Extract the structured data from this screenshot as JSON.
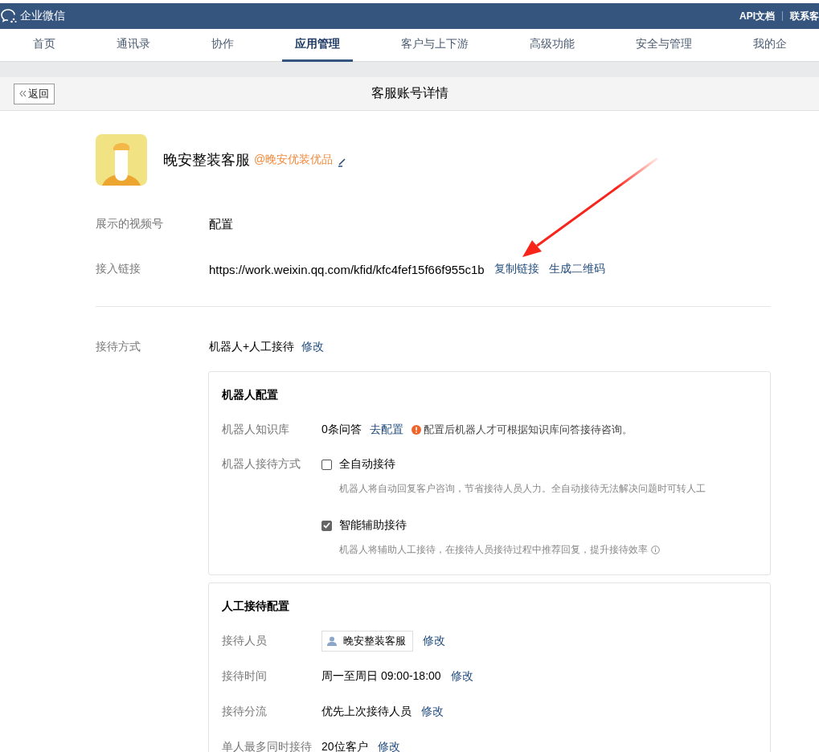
{
  "brand": {
    "name": "企业微信"
  },
  "top_links": [
    "API文档",
    "联系客"
  ],
  "nav": [
    {
      "label": "首页",
      "selected": false
    },
    {
      "label": "通讯录",
      "selected": false
    },
    {
      "label": "协作",
      "selected": false
    },
    {
      "label": "应用管理",
      "selected": true
    },
    {
      "label": "客户与上下游",
      "selected": false
    },
    {
      "label": "高级功能",
      "selected": false
    },
    {
      "label": "安全与管理",
      "selected": false
    },
    {
      "label": "我的企",
      "selected": false
    }
  ],
  "header": {
    "back": "返回",
    "title": "客服账号详情"
  },
  "account": {
    "name": "晚安整装客服",
    "corp": "@晚安优装优品"
  },
  "info_rows": [
    {
      "label": "展示的视频号",
      "value": "配置",
      "links": []
    },
    {
      "label": "接入链接",
      "value": "https://work.weixin.qq.com/kfid/kfc4fef15f66f955c1b",
      "links": [
        "复制链接",
        "生成二维码"
      ]
    }
  ],
  "reception": {
    "label": "接待方式",
    "value": "机器人+人工接待",
    "link": "修改"
  },
  "robot": {
    "title": "机器人配置",
    "knowledge": {
      "label": "机器人知识库",
      "value": "0条问答",
      "link": "去配置",
      "warning": "配置后机器人才可根据知识库问答接待咨询。"
    },
    "mode_label": "机器人接待方式",
    "modes": [
      {
        "label": "全自动接待",
        "checked": false,
        "desc": "机器人将自动回复客户咨询，节省接待人员人力。全自动接待无法解决问题时可转人工",
        "info": false
      },
      {
        "label": "智能辅助接待",
        "checked": true,
        "desc": "机器人将辅助人工接待，在接待人员接待过程中推荐回复，提升接待效率",
        "info": true
      }
    ]
  },
  "manual": {
    "title": "人工接待配置",
    "rows": [
      {
        "kind": "person",
        "label": "接待人员",
        "value": "晚安整装客服",
        "link": "修改"
      },
      {
        "kind": "text",
        "label": "接待时间",
        "value": "周一至周日 09:00-18:00",
        "link": "修改"
      },
      {
        "kind": "text",
        "label": "接待分流",
        "value": "优先上次接待人员",
        "link": "修改"
      },
      {
        "kind": "text",
        "label": "单人最多同时接待",
        "value": "20位客户",
        "link": "修改"
      }
    ]
  }
}
